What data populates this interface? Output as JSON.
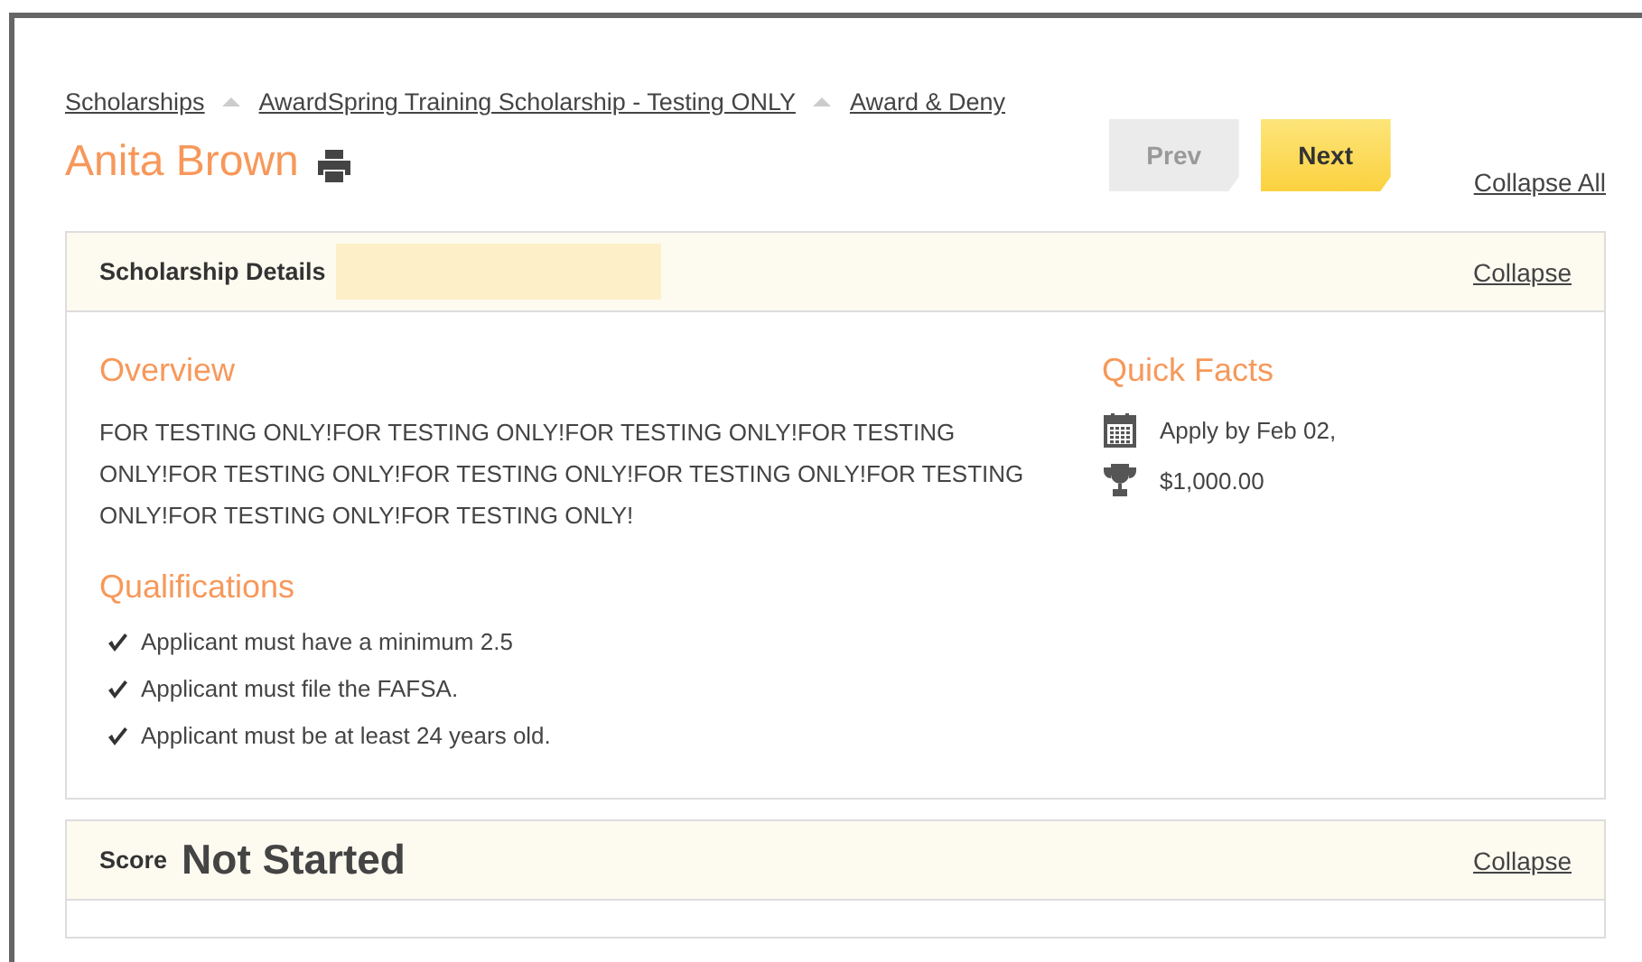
{
  "breadcrumbs": [
    "Scholarships",
    "AwardSpring Training Scholarship - Testing ONLY",
    "Award & Deny"
  ],
  "applicant": {
    "name": "Anita Brown"
  },
  "nav_buttons": [
    {
      "label": "Prev",
      "disabled": true
    },
    {
      "label": "Next",
      "disabled": false
    }
  ],
  "collapse_all": "Collapse All",
  "details_panel": {
    "title": "Scholarship Details",
    "collapse": "Collapse",
    "overview": {
      "heading": "Overview",
      "text": "FOR TESTING ONLY!FOR TESTING ONLY!FOR TESTING ONLY!FOR TESTING ONLY!FOR TESTING ONLY!FOR TESTING ONLY!FOR TESTING ONLY!FOR TESTING ONLY!FOR TESTING ONLY!FOR TESTING ONLY!"
    },
    "qualifications": {
      "heading": "Qualifications",
      "items": [
        "Applicant must have a minimum 2.5",
        "Applicant must file the FAFSA.",
        "Applicant must be at least 24 years old."
      ]
    },
    "quick_facts": {
      "heading": "Quick Facts",
      "items": [
        {
          "kind": "deadline",
          "text": "Apply by Feb 02,"
        },
        {
          "kind": "award",
          "text": "$1,000.00"
        }
      ]
    }
  },
  "score_panel": {
    "label": "Score",
    "status": "Not Started",
    "collapse": "Collapse"
  }
}
